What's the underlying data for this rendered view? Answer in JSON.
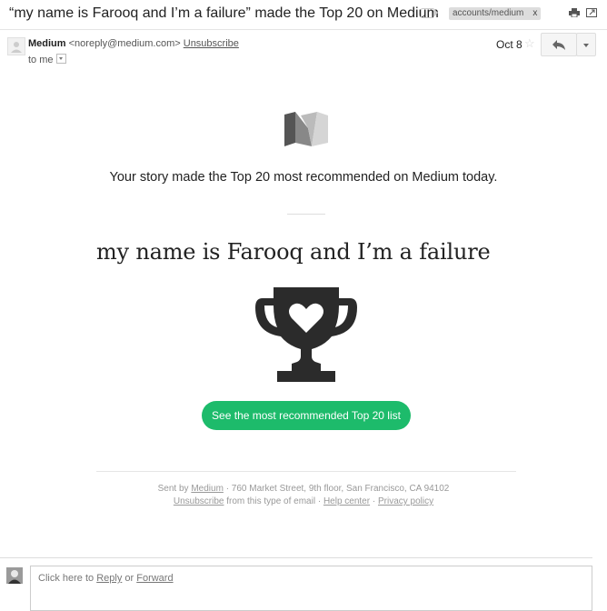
{
  "email": {
    "subject": "“my name is Farooq and I’m a failure” made the Top 20 on Medium",
    "label_tag": "accounts/medium",
    "label_close": "x",
    "sender_name": "Medium",
    "sender_email": "<noreply@medium.com>",
    "unsubscribe": "Unsubscribe",
    "to": "to me",
    "date": "Oct 8"
  },
  "body": {
    "tagline": "Your story made the Top 20 most recommended on Medium today.",
    "story_title": "my name is Farooq and I’m a failure",
    "cta_label": "See the most recommended Top 20 list"
  },
  "footer": {
    "sent_by": "Sent by",
    "medium_link": "Medium",
    "address": "· 760 Market Street, 9th floor, San Francisco, CA 94102",
    "unsubscribe_link": "Unsubscribe",
    "from_type": "from this type of email ·",
    "help_link": "Help center",
    "separator": "·",
    "privacy_link": "Privacy policy"
  },
  "reply_area": {
    "prefix": "Click here to",
    "reply_link": "Reply",
    "or": "or",
    "forward_link": "Forward"
  },
  "colors": {
    "cta_green": "#1dbb6b",
    "trophy": "#2b2b2b"
  },
  "icons": [
    "label-icon",
    "print-icon",
    "popout-icon",
    "star-icon",
    "reply-icon",
    "more-icon",
    "medium-logo-icon",
    "trophy-heart-icon"
  ]
}
